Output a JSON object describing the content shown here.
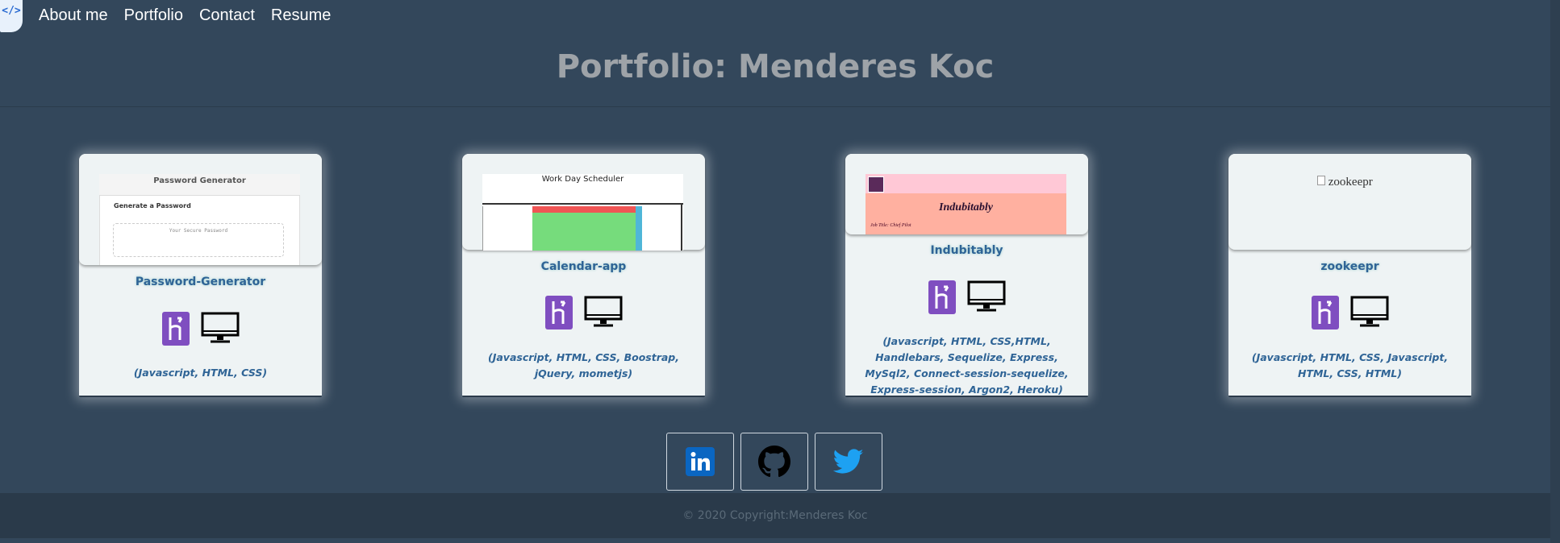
{
  "nav": {
    "logo_glyph": "</>",
    "links": [
      "About me",
      "Portfolio",
      "Contact",
      "Resume"
    ]
  },
  "page_title": "Portfolio: Menderes Koc",
  "projects": [
    {
      "name": "Password-Generator",
      "tech": "(Javascript, HTML, CSS)",
      "thumbnail": {
        "heading": "Password Generator",
        "subheading": "Generate a Password",
        "placeholder": "Your Secure Password"
      }
    },
    {
      "name": "Calendar-app",
      "tech": "(Javascript, HTML, CSS, Boostrap, jQuery, mometjs)",
      "thumbnail": {
        "heading": "Work Day Scheduler"
      }
    },
    {
      "name": "Indubitably",
      "tech": "(Javascript, HTML, CSS,HTML, Handlebars, Sequelize, Express, MySql2, Connect-session-sequelize, Express-session, Argon2, Heroku)",
      "thumbnail": {
        "heading": "Indubitably",
        "subheading": "Job Title: Chief Pilot"
      }
    },
    {
      "name": "zookeepr",
      "tech": "(Javascript, HTML, CSS, Javascript, HTML, CSS, HTML)",
      "thumbnail": {
        "alt": "zookeepr"
      }
    }
  ],
  "icons": {
    "deploy": "heroku-icon",
    "repo": "monitor-icon"
  },
  "social": [
    "linkedin-icon",
    "github-icon",
    "twitter-icon"
  ],
  "footer": "© 2020 Copyright:Menderes Koc",
  "colors": {
    "background": "#33475b",
    "card": "#eef3f4",
    "accent": "#2f6496",
    "heroku": "#7f4ec0",
    "linkedin": "#0a66c2",
    "twitter": "#1da1f2"
  }
}
